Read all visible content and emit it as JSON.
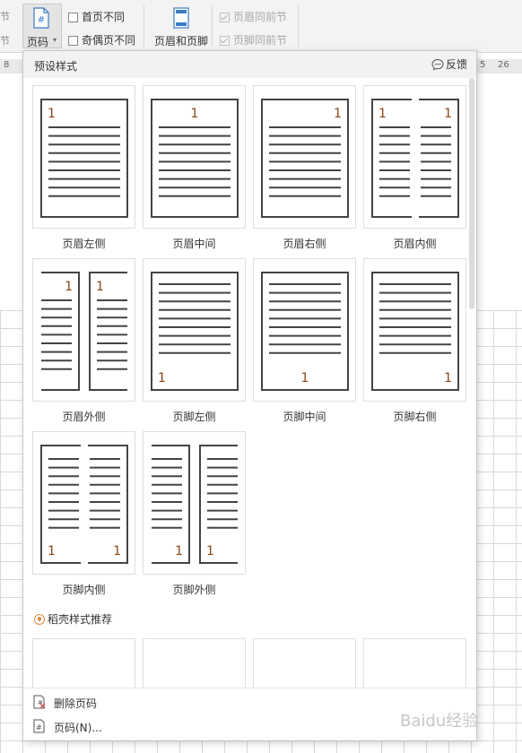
{
  "ribbon": {
    "edge_top": "节",
    "edge_bottom": "节",
    "page_number_label": "页码",
    "page_number_icon": "#",
    "checkbox_first_page": "首页不同",
    "checkbox_odd_even": "奇偶页不同",
    "header_footer_label": "页眉和页脚",
    "checkbox_header_same": "页眉同前节",
    "checkbox_footer_same": "页脚同前节"
  },
  "ruler": {
    "left_number": "8",
    "mark_a": "5",
    "mark_b": "26"
  },
  "dropdown": {
    "title": "预设样式",
    "feedback": "反馈",
    "styles": [
      {
        "label": "页眉左侧",
        "layout": "single",
        "pos": "top-left"
      },
      {
        "label": "页眉中间",
        "layout": "single",
        "pos": "top-center"
      },
      {
        "label": "页眉右侧",
        "layout": "single",
        "pos": "top-right"
      },
      {
        "label": "页眉内侧",
        "layout": "spread",
        "pos": "top-inner"
      },
      {
        "label": "页眉外侧",
        "layout": "spread",
        "pos": "top-outer"
      },
      {
        "label": "页脚左侧",
        "layout": "single",
        "pos": "bottom-left"
      },
      {
        "label": "页脚中间",
        "layout": "single",
        "pos": "bottom-center"
      },
      {
        "label": "页脚右侧",
        "layout": "single",
        "pos": "bottom-right"
      },
      {
        "label": "页脚内侧",
        "layout": "spread",
        "pos": "bottom-inner"
      },
      {
        "label": "页脚外侧",
        "layout": "spread",
        "pos": "bottom-outer"
      }
    ],
    "page_number_digit": "1",
    "recommend_label": "稻壳样式推荐",
    "remove_label": "删除页码",
    "page_number_dialog_label": "页码(N)..."
  },
  "watermark": "Baidu经验",
  "colors": {
    "accent_number": "#8b4513",
    "line": "#444444"
  }
}
